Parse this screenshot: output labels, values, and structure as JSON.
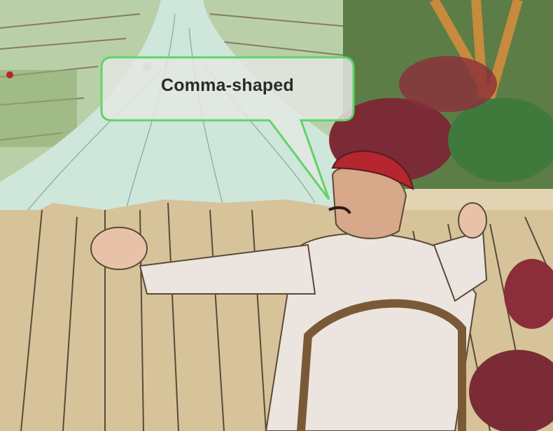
{
  "speech_bubble": {
    "text": "Comma-shaped",
    "border_color": "#5fd46a",
    "fill_color": "#e4e6e2"
  },
  "colors": {
    "river": "#cfe6da",
    "fence": "#d6c39a",
    "beret": "#b5262f",
    "uniform": "#ece4de",
    "foliage": "#4f7a3c"
  }
}
